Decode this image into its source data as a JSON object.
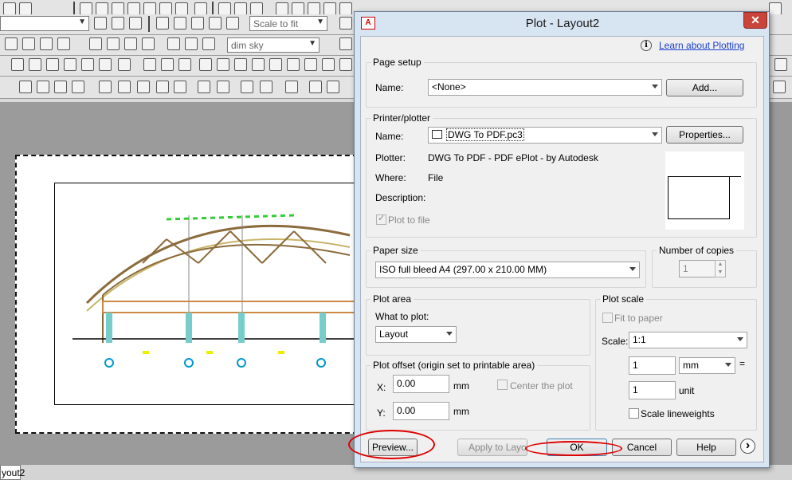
{
  "app": {
    "toolbar": {
      "scale_combo": "Scale to fit",
      "visual_style_combo": "dim sky"
    },
    "layout_tab": "yout2"
  },
  "dialog": {
    "title": "Plot - Layout2",
    "learn_link": "Learn about Plotting",
    "page_setup": {
      "title": "Page setup",
      "name_label": "Name:",
      "name_value": "<None>",
      "add_button": "Add..."
    },
    "printer": {
      "title": "Printer/plotter",
      "name_label": "Name:",
      "name_value": "DWG To PDF.pc3",
      "properties_button": "Properties...",
      "plotter_label": "Plotter:",
      "plotter_value": "DWG To PDF - PDF ePlot - by Autodesk",
      "where_label": "Where:",
      "where_value": "File",
      "description_label": "Description:",
      "plot_to_file": "Plot to file"
    },
    "paper_size": {
      "title": "Paper size",
      "value": "ISO full bleed A4 (297.00 x 210.00 MM)"
    },
    "copies": {
      "title": "Number of copies",
      "value": "1"
    },
    "plot_area": {
      "title": "Plot area",
      "what_label": "What to plot:",
      "what_value": "Layout"
    },
    "plot_offset": {
      "title": "Plot offset (origin set to printable area)",
      "x_label": "X:",
      "x_value": "0.00",
      "x_unit": "mm",
      "y_label": "Y:",
      "y_value": "0.00",
      "y_unit": "mm",
      "center_label": "Center the plot"
    },
    "plot_scale": {
      "title": "Plot scale",
      "fit_label": "Fit to paper",
      "scale_label": "Scale:",
      "scale_value": "1:1",
      "value1": "1",
      "unit1": "mm",
      "equals": "=",
      "value2": "1",
      "unit2": "unit",
      "lineweights_label": "Scale lineweights"
    },
    "buttons": {
      "preview": "Preview...",
      "apply": "Apply to Layout",
      "ok": "OK",
      "cancel": "Cancel",
      "help": "Help",
      "more": "›"
    },
    "annotation_color": "#e00000"
  }
}
